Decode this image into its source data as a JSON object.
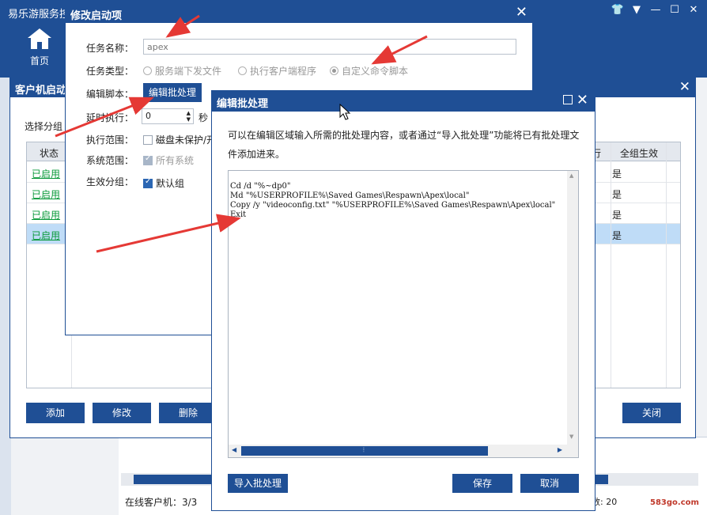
{
  "main": {
    "title": "易乐游服务控",
    "nav_home_label": "首页",
    "status_online": "在线客户机：3/3",
    "status_right": "数: 20",
    "watermark": "583go.com"
  },
  "client_dialog": {
    "title": "客户机启动",
    "group_label": "选择分组",
    "columns": {
      "status": "状态",
      "run": "行",
      "all_group": "全组生效"
    },
    "rows": [
      {
        "status": "已启用",
        "all": "是"
      },
      {
        "status": "已启用",
        "all": "是"
      },
      {
        "status": "已启用",
        "all": "是"
      },
      {
        "status": "已启用",
        "all": "是"
      }
    ],
    "buttons": {
      "add": "添加",
      "modify": "修改",
      "delete": "删除",
      "close": "关闭"
    }
  },
  "edit_dialog": {
    "title": "修改启动项",
    "task_name_label": "任务名称：",
    "task_name_value": "apex",
    "task_type_label": "任务类型：",
    "type_options": [
      "服务端下发文件",
      "执行客户端程序",
      "自定义命令脚本"
    ],
    "script_label": "编辑脚本：",
    "edit_batch_button": "编辑批处理",
    "delay_label": "延时执行：",
    "delay_value": "0",
    "delay_unit": "秒",
    "scope_label": "执行范围：",
    "scope_option": "磁盘未保护/开",
    "system_label": "系统范围：",
    "system_option": "所有系统",
    "group_label": "生效分组：",
    "group_option": "默认组"
  },
  "batch_dialog": {
    "title": "编辑批处理",
    "description": "可以在编辑区域输入所需的批处理内容，或者通过“导入批处理”功能将已有批处理文件添加进来。",
    "code_lines": [
      "Cd /d \"%~dp0\"",
      "Md \"%USERPROFILE%\\Saved Games\\Respawn\\Apex\\local\"",
      "Copy /y \"videoconfig.txt\" \"%USERPROFILE%\\Saved Games\\Respawn\\Apex\\local\"",
      "Exit"
    ],
    "buttons": {
      "import": "导入批处理",
      "save": "保存",
      "cancel": "取消"
    }
  },
  "colors": {
    "brand": "#1f4f95",
    "enabled": "#0a9a3a",
    "selected_row": "#bfdcf7",
    "annotation": "#e53935"
  }
}
